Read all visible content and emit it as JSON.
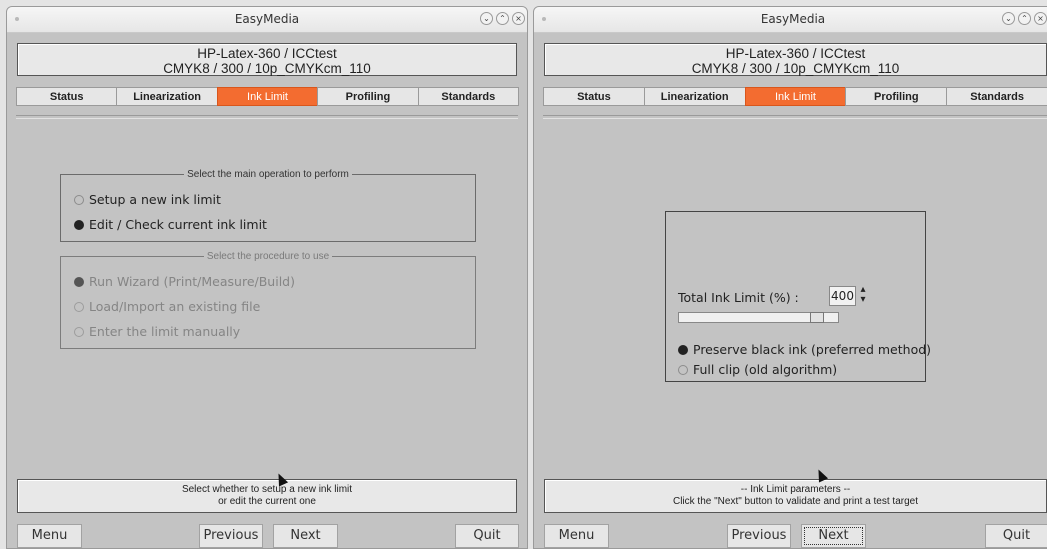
{
  "windows": [
    {
      "title": "EasyMedia",
      "header": {
        "line1": "HP-Latex-360 / ICCtest",
        "line2": "CMYK8 / 300 / 10p_CMYKcm_110"
      },
      "tabs": [
        "Status",
        "Linearization",
        "Ink Limit",
        "Profiling",
        "Standards"
      ],
      "active_tab": "Ink Limit",
      "main_group": {
        "legend": "Select the main operation to perform",
        "options": [
          "Setup a new ink limit",
          "Edit / Check current ink limit"
        ],
        "selected": "Edit / Check current ink limit"
      },
      "procedure_group": {
        "legend": "Select the procedure to use",
        "options": [
          "Run Wizard (Print/Measure/Build)",
          "Load/Import an existing file",
          "Enter the limit manually"
        ],
        "selected": "Run Wizard (Print/Measure/Build)",
        "enabled": false
      },
      "message": {
        "line1": "Select whether to setup a new ink limit",
        "line2": "or edit the current one"
      },
      "buttons": {
        "menu": "Menu",
        "previous": "Previous",
        "next": "Next",
        "quit": "Quit"
      }
    },
    {
      "title": "EasyMedia",
      "header": {
        "line1": "HP-Latex-360 / ICCtest",
        "line2": "CMYK8 / 300 / 10p_CMYKcm_110"
      },
      "tabs": [
        "Status",
        "Linearization",
        "Ink Limit",
        "Profiling",
        "Standards"
      ],
      "active_tab": "Ink Limit",
      "ink_limit": {
        "label": "Total Ink Limit (%)  :",
        "value": "400",
        "slider_fraction": 0.9,
        "options": [
          "Preserve black ink (preferred method)",
          "Full clip (old algorithm)"
        ],
        "selected": "Preserve black ink (preferred method)"
      },
      "message": {
        "line1": "-- Ink Limit parameters --",
        "line2": "Click the \"Next\" button to validate and print a test target"
      },
      "buttons": {
        "menu": "Menu",
        "previous": "Previous",
        "next": "Next",
        "quit": "Quit"
      }
    }
  ],
  "colors": {
    "active_tab": "#f36c30",
    "window_bg": "#c3c3c3"
  },
  "icons": [
    "minimize-icon",
    "maximize-icon",
    "close-icon",
    "mouse-cursor"
  ]
}
